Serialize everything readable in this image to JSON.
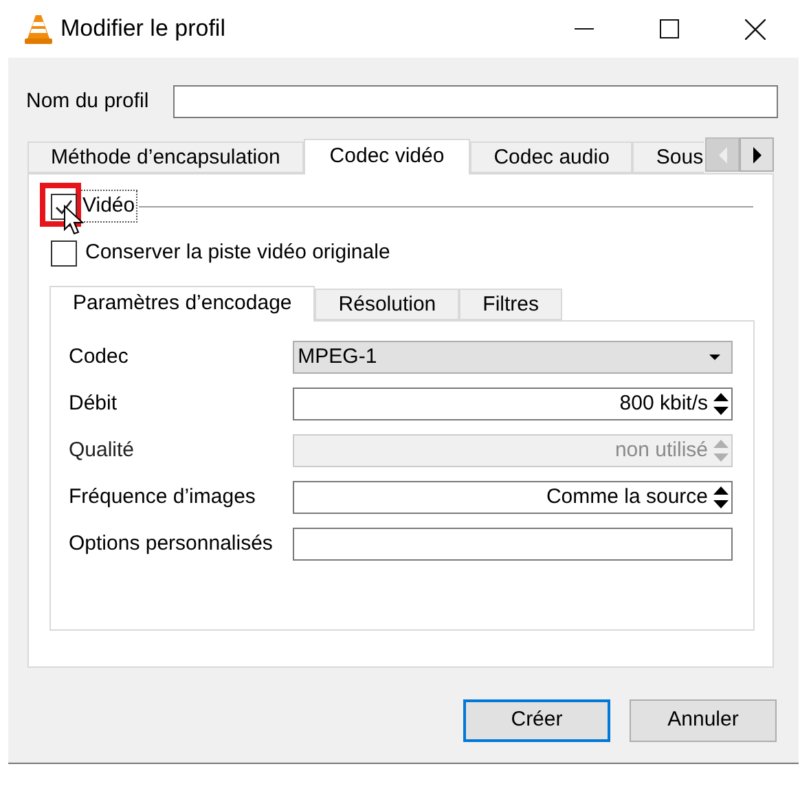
{
  "window": {
    "title": "Modifier le profil"
  },
  "profile_name": {
    "label": "Nom du profil"
  },
  "tabs": [
    {
      "label": "Méthode d’encapsulation",
      "selected": false
    },
    {
      "label": "Codec vidéo",
      "selected": true
    },
    {
      "label": "Codec audio",
      "selected": false
    },
    {
      "label": "Sous",
      "selected": false
    }
  ],
  "video": {
    "label": "Vidéo",
    "checked": true,
    "highlighted": true
  },
  "keep_original": {
    "label": "Conserver la piste vidéo originale",
    "checked": false
  },
  "subtabs": [
    {
      "label": "Paramètres d’encodage",
      "selected": true
    },
    {
      "label": "Résolution",
      "selected": false
    },
    {
      "label": "Filtres",
      "selected": false
    }
  ],
  "fields": [
    {
      "label": "Codec",
      "kind": "dropdown",
      "value": "MPEG-1",
      "disabled": false
    },
    {
      "label": "Débit",
      "kind": "spin",
      "value": "800 kbit/s",
      "disabled": false
    },
    {
      "label": "Qualité",
      "kind": "spin",
      "value": "non utilisé",
      "disabled": true
    },
    {
      "label": "Fréquence d’images",
      "kind": "spin",
      "value": "Comme la source",
      "disabled": false
    },
    {
      "label": "Options personnalisés",
      "kind": "text",
      "disabled": false
    }
  ],
  "buttons": [
    {
      "label": "Créer",
      "default": true
    },
    {
      "label": "Annuler",
      "default": false
    }
  ]
}
